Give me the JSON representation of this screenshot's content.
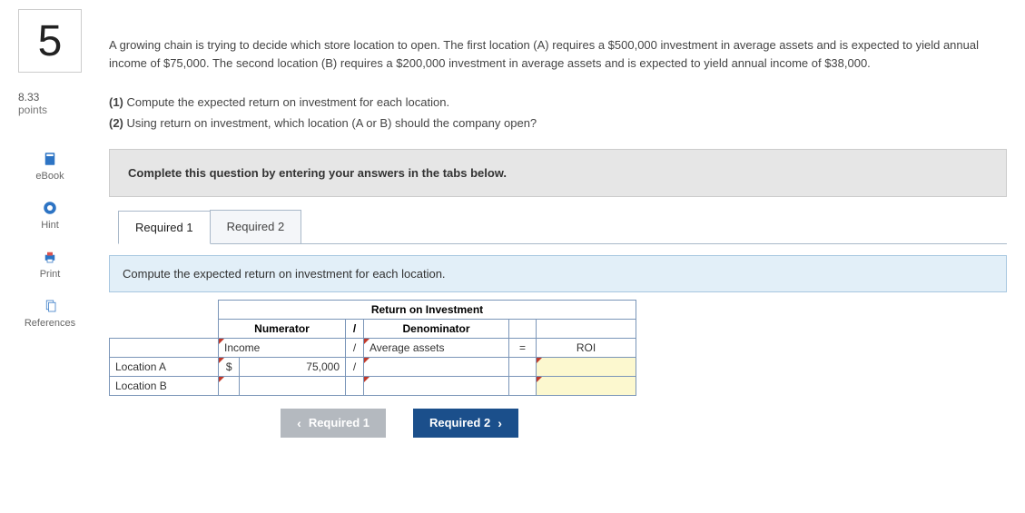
{
  "sidebar": {
    "question_number": "5",
    "points_value": "8.33",
    "points_label": "points",
    "tools": {
      "ebook": "eBook",
      "hint": "Hint",
      "print": "Print",
      "references": "References"
    }
  },
  "question": {
    "prompt": "A growing chain is trying to decide which store location to open. The first location (A) requires a $500,000 investment in average assets and is expected to yield annual income of $75,000. The second location (B) requires a $200,000 investment in average assets and is expected to yield annual income of $38,000.",
    "part1_label": "(1)",
    "part1_text": "Compute the expected return on investment for each location.",
    "part2_label": "(2)",
    "part2_text": "Using return on investment, which location (A or B) should the company open?"
  },
  "banner": "Complete this question by entering your answers in the tabs below.",
  "tabs": {
    "t1": "Required 1",
    "t2": "Required 2"
  },
  "tab1": {
    "instruction": "Compute the expected return on investment for each location.",
    "table": {
      "title": "Return on Investment",
      "numerator": "Numerator",
      "slash": "/",
      "denominator": "Denominator",
      "numerator_label": "Income",
      "denominator_label": "Average assets",
      "equals": "=",
      "result_label": "ROI",
      "rows": [
        {
          "label": "Location A",
          "cur": "$",
          "num": "75,000",
          "den": "",
          "roi": ""
        },
        {
          "label": "Location B",
          "cur": "",
          "num": "",
          "den": "",
          "roi": ""
        }
      ]
    }
  },
  "nav": {
    "prev": "Required 1",
    "next": "Required 2"
  }
}
